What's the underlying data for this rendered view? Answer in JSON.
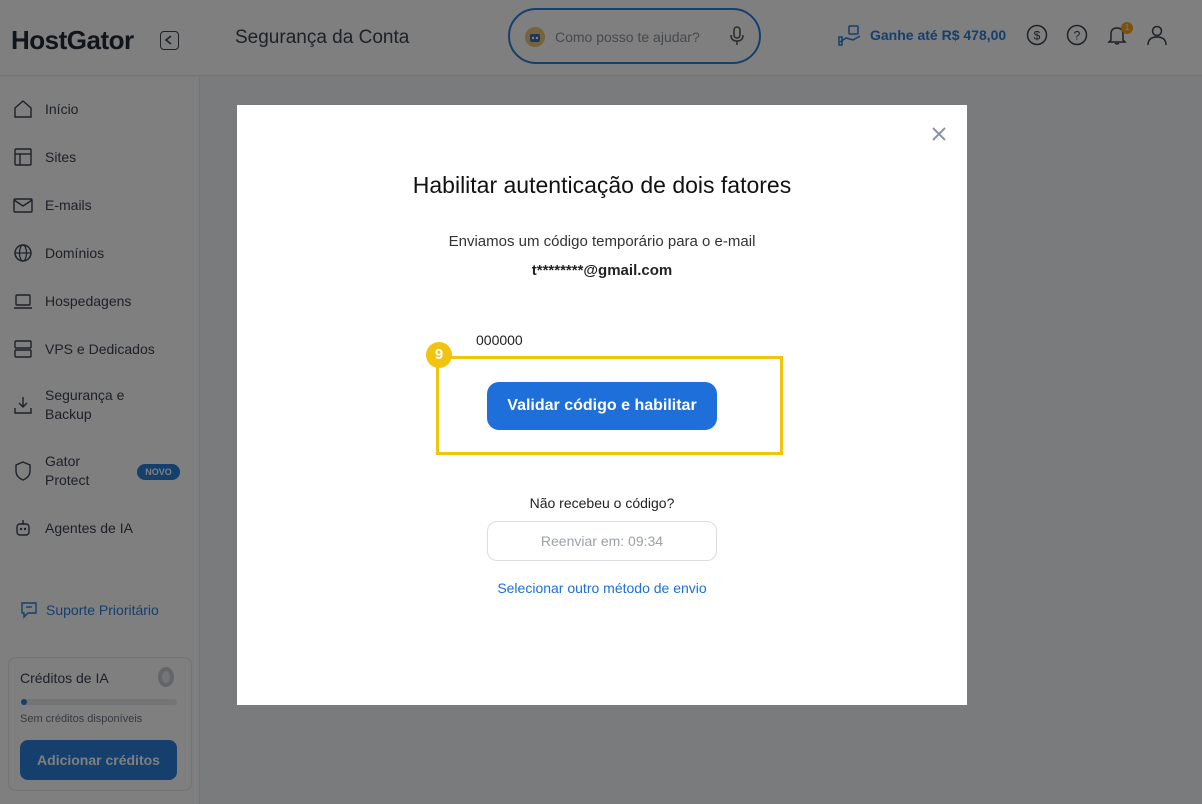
{
  "header": {
    "logo": "HostGator",
    "page_title": "Segurança da Conta",
    "search_placeholder": "Como posso te ajudar?",
    "earn_label": "Ganhe até R$ 478,00",
    "notifications_count": "1"
  },
  "sidebar": {
    "items": [
      {
        "label": "Início",
        "icon": "home-icon"
      },
      {
        "label": "Sites",
        "icon": "sites-icon"
      },
      {
        "label": "E-mails",
        "icon": "mail-icon"
      },
      {
        "label": "Domínios",
        "icon": "globe-icon"
      },
      {
        "label": "Hospedagens",
        "icon": "laptop-icon"
      },
      {
        "label": "VPS e Dedicados",
        "icon": "server-icon"
      },
      {
        "label": "Segurança e\nBackup",
        "icon": "download-icon"
      },
      {
        "label": "Gator\nProtect",
        "icon": "shield-icon"
      },
      {
        "label": "Agentes de IA",
        "icon": "robot-icon"
      }
    ],
    "novo_badge": "NOVO",
    "support_label": "Suporte Prioritário",
    "credits": {
      "title": "Créditos de IA",
      "note": "Sem créditos disponíveis",
      "button": "Adicionar créditos"
    }
  },
  "modal": {
    "title": "Habilitar autenticação de dois fatores",
    "description": "Enviamos um código temporário para o e-mail",
    "email": "t********@gmail.com",
    "code_value": "000000",
    "step_number": "9",
    "validate_button": "Validar código e habilitar",
    "not_received": "Não recebeu o código?",
    "resend_button": "Reenviar em: 09:34",
    "other_method": "Selecionar outro método de envio"
  },
  "colors": {
    "accent": "#1e6fd9",
    "highlight": "#f1c40f",
    "overlay": "rgba(0,0,0,0.5)"
  }
}
